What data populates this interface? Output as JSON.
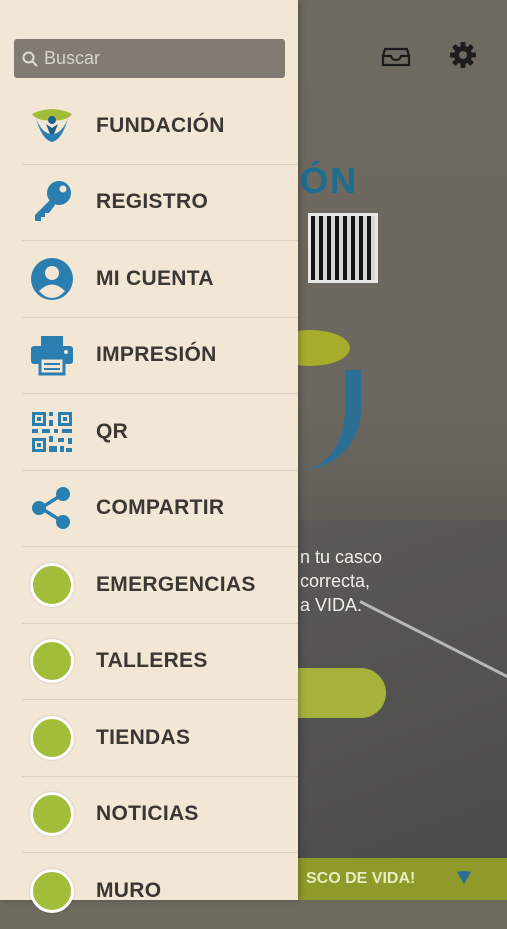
{
  "search": {
    "placeholder": "Buscar"
  },
  "menu": {
    "items": [
      {
        "label": "FUNDACIÓN",
        "icon": "fundacion-logo-icon"
      },
      {
        "label": "REGISTRO",
        "icon": "key-icon"
      },
      {
        "label": "MI CUENTA",
        "icon": "account-icon"
      },
      {
        "label": "IMPRESIÓN",
        "icon": "printer-icon"
      },
      {
        "label": "QR",
        "icon": "qr-code-icon"
      },
      {
        "label": "COMPARTIR",
        "icon": "share-icon"
      },
      {
        "label": "EMERGENCIAS",
        "icon": "green-dot-icon"
      },
      {
        "label": "TALLERES",
        "icon": "green-dot-icon"
      },
      {
        "label": "TIENDAS",
        "icon": "green-dot-icon"
      },
      {
        "label": "NOTICIAS",
        "icon": "green-dot-icon"
      },
      {
        "label": "MURO",
        "icon": "green-dot-icon"
      }
    ]
  },
  "background": {
    "title": "IÓN",
    "text_lines": [
      "n tu casco",
      "correcta,",
      "a VIDA."
    ],
    "bottom_bar": "SCO DE VIDA!"
  },
  "colors": {
    "accent_blue": "#2b6f95",
    "accent_green": "#a2bd3a",
    "drawer_bg": "#f2e6d5"
  }
}
